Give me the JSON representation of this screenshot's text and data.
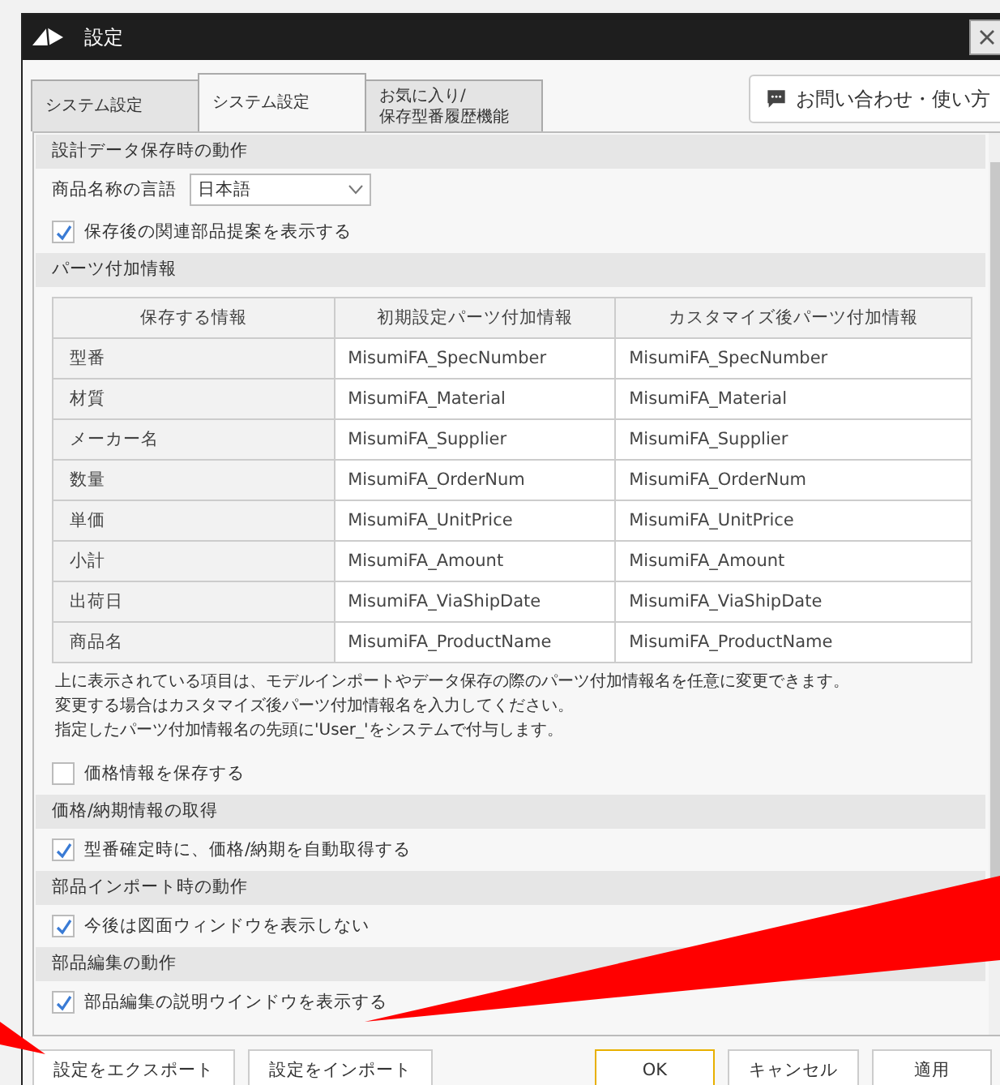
{
  "window": {
    "title": "設定"
  },
  "tabs": [
    {
      "label": "システム設定",
      "selected": false
    },
    {
      "label": "システム設定",
      "selected": true
    },
    {
      "label": "お気に入り/\n保存型番履歴機能",
      "selected": false
    }
  ],
  "help_button": {
    "label": "お問い合わせ・使い方"
  },
  "sections": [
    {
      "title": "設計データ保存時の動作",
      "items": [
        {
          "kind": "dropdown",
          "label": "商品名称の言語",
          "value": "日本語"
        },
        {
          "kind": "checkbox",
          "label": "保存後の関連部品提案を表示する",
          "checked": true
        }
      ]
    },
    {
      "title": "パーツ付加情報",
      "items": [
        {
          "kind": "table",
          "columns": [
            "保存する情報",
            "初期設定パーツ付加情報",
            "カスタマイズ後パーツ付加情報"
          ],
          "rows": [
            [
              "型番",
              "MisumiFA_SpecNumber",
              "MisumiFA_SpecNumber"
            ],
            [
              "材質",
              "MisumiFA_Material",
              "MisumiFA_Material"
            ],
            [
              "メーカー名",
              "MisumiFA_Supplier",
              "MisumiFA_Supplier"
            ],
            [
              "数量",
              "MisumiFA_OrderNum",
              "MisumiFA_OrderNum"
            ],
            [
              "単価",
              "MisumiFA_UnitPrice",
              "MisumiFA_UnitPrice"
            ],
            [
              "小計",
              "MisumiFA_Amount",
              "MisumiFA_Amount"
            ],
            [
              "出荷日",
              "MisumiFA_ViaShipDate",
              "MisumiFA_ViaShipDate"
            ],
            [
              "商品名",
              "MisumiFA_ProductName",
              "MisumiFA_ProductName"
            ]
          ]
        },
        {
          "kind": "note",
          "lines": [
            "上に表示されている項目は、モデルインポートやデータ保存の際のパーツ付加情報名を任意に変更できます。",
            "変更する場合はカスタマイズ後パーツ付加情報名を入力してください。",
            "指定したパーツ付加情報名の先頭に'User_'をシステムで付与します。"
          ]
        },
        {
          "kind": "checkbox",
          "label": "価格情報を保存する",
          "checked": false
        }
      ]
    },
    {
      "title": "価格/納期情報の取得",
      "items": [
        {
          "kind": "checkbox",
          "label": "型番確定時に、価格/納期を自動取得する",
          "checked": true
        }
      ]
    },
    {
      "title": "部品インポート時の動作",
      "items": [
        {
          "kind": "checkbox",
          "label": "今後は図面ウィンドウを表示しない",
          "checked": true
        }
      ]
    },
    {
      "title": "部品編集の動作",
      "items": [
        {
          "kind": "checkbox",
          "label": "部品編集の説明ウインドウを表示する",
          "checked": true
        }
      ]
    }
  ],
  "footer_buttons": [
    {
      "label": "設定をエクスポート",
      "kind": "left"
    },
    {
      "label": "設定をインポート",
      "kind": "left"
    },
    {
      "label": "OK",
      "kind": "default"
    },
    {
      "label": "キャンセル",
      "kind": "right"
    },
    {
      "label": "適用",
      "kind": "right"
    }
  ]
}
